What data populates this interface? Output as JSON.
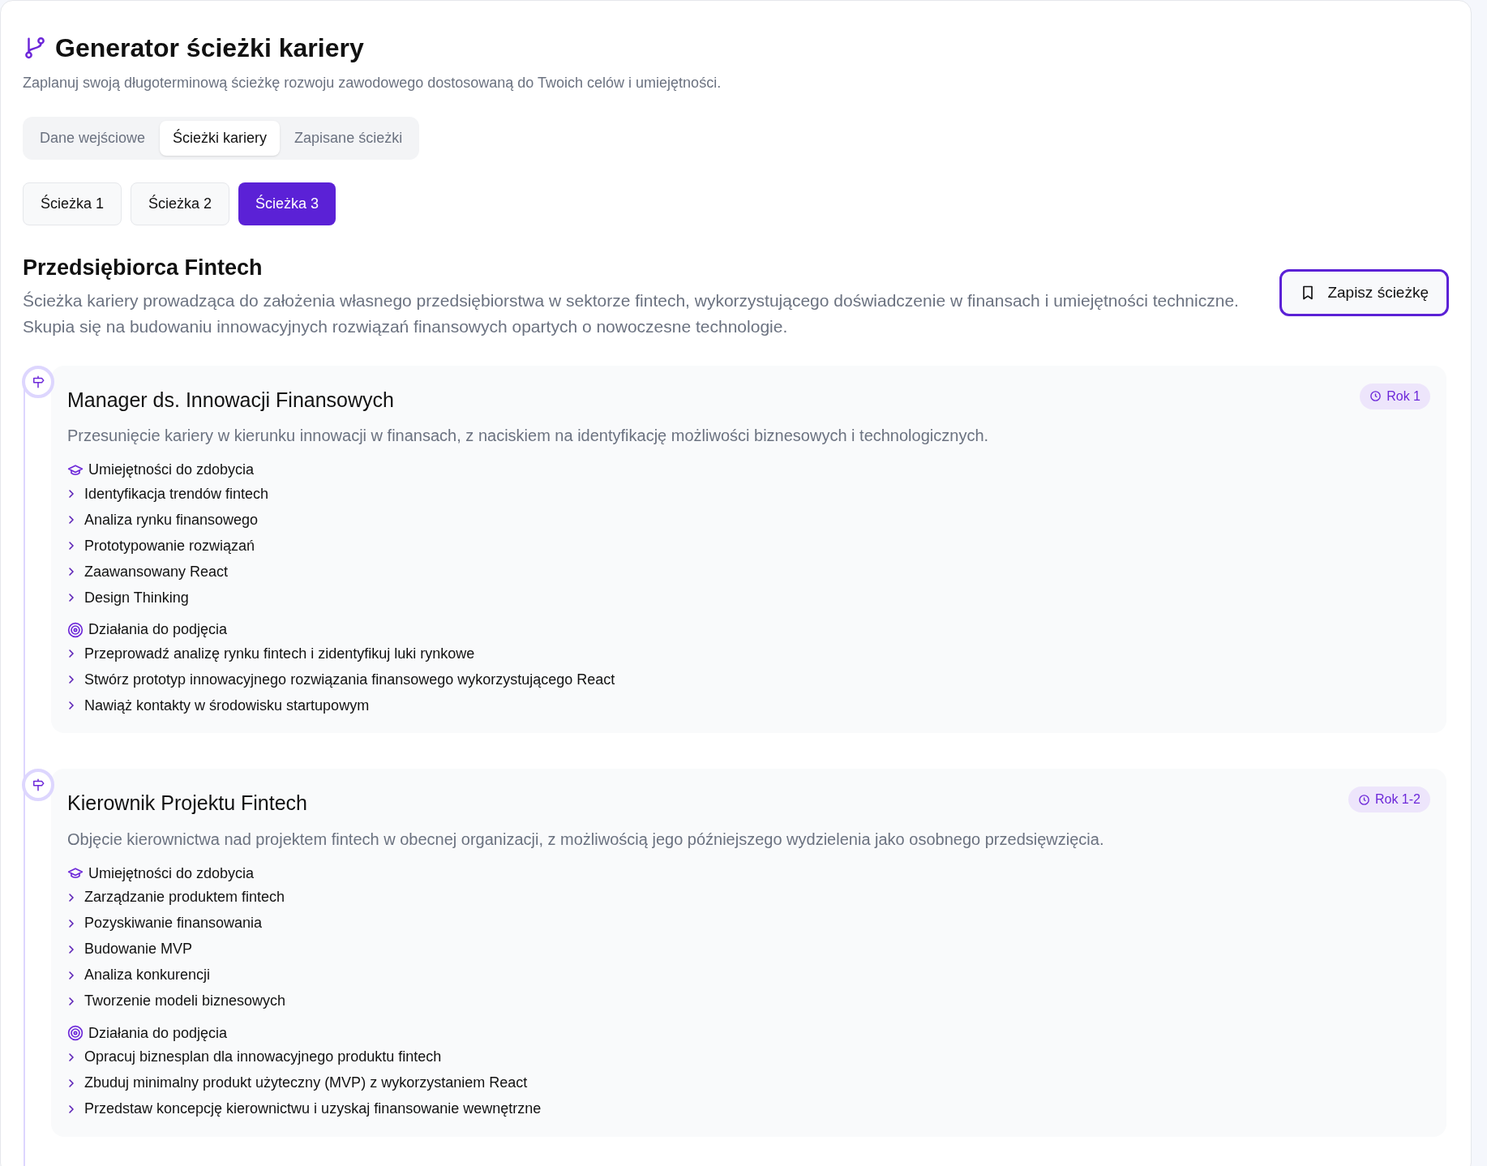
{
  "header": {
    "title": "Generator ścieżki kariery",
    "subtitle": "Zaplanuj swoją długoterminową ścieżkę rozwoju zawodowego dostosowaną do Twoich celów i umiejętności."
  },
  "tabs": [
    {
      "label": "Dane wejściowe",
      "selected": false
    },
    {
      "label": "Ścieżki kariery",
      "selected": true
    },
    {
      "label": "Zapisane ścieżki",
      "selected": false
    }
  ],
  "paths": [
    {
      "label": "Ścieżka 1",
      "selected": false
    },
    {
      "label": "Ścieżka 2",
      "selected": false
    },
    {
      "label": "Ścieżka 3",
      "selected": true
    }
  ],
  "path": {
    "title": "Przedsiębiorca Fintech",
    "description": "Ścieżka kariery prowadząca do założenia własnego przedsiębiorstwa w sektorze fintech, wykorzystującego doświadczenie w finansach i umiejętności techniczne. Skupia się na budowaniu innowacyjnych rozwiązań finansowych opartych o nowoczesne technologie.",
    "save_button": "Zapisz ścieżkę"
  },
  "steps": [
    {
      "title": "Manager ds. Innowacji Finansowych",
      "badge": "Rok 1",
      "description": "Przesunięcie kariery w kierunku innowacji w finansach, z naciskiem na identyfikację możliwości biznesowych i technologicznych.",
      "skills_heading": "Umiejętności do zdobycia",
      "skills": [
        "Identyfikacja trendów fintech",
        "Analiza rynku finansowego",
        "Prototypowanie rozwiązań",
        "Zaawansowany React",
        "Design Thinking"
      ],
      "actions_heading": "Działania do podjęcia",
      "actions": [
        "Przeprowadź analizę rynku fintech i zidentyfikuj luki rynkowe",
        "Stwórz prototyp innowacyjnego rozwiązania finansowego wykorzystującego React",
        "Nawiąż kontakty w środowisku startupowym"
      ]
    },
    {
      "title": "Kierownik Projektu Fintech",
      "badge": "Rok 1-2",
      "description": "Objęcie kierownictwa nad projektem fintech w obecnej organizacji, z możliwością jego późniejszego wydzielenia jako osobnego przedsięwzięcia.",
      "skills_heading": "Umiejętności do zdobycia",
      "skills": [
        "Zarządzanie produktem fintech",
        "Pozyskiwanie finansowania",
        "Budowanie MVP",
        "Analiza konkurencji",
        "Tworzenie modeli biznesowych"
      ],
      "actions_heading": "Działania do podjęcia",
      "actions": [
        "Opracuj biznesplan dla innowacyjnego produktu fintech",
        "Zbuduj minimalny produkt użyteczny (MVP) z wykorzystaniem React",
        "Przedstaw koncepcję kierownictwu i uzyskaj finansowanie wewnętrzne"
      ]
    }
  ]
}
